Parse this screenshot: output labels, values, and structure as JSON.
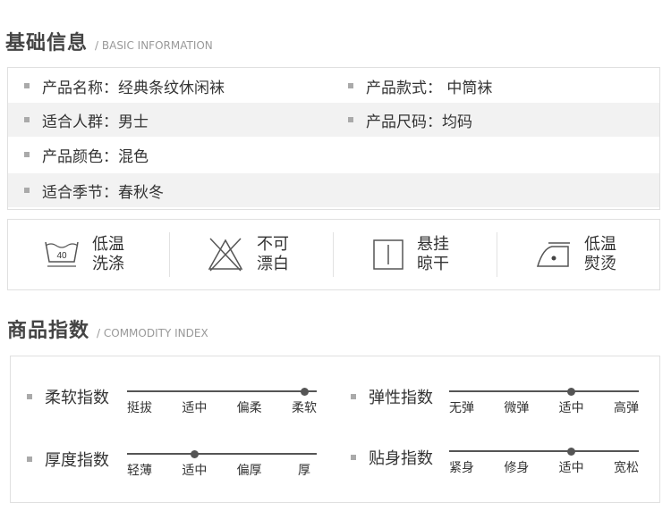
{
  "basic": {
    "title": "基础信息",
    "subtitle": "/ BASIC INFORMATION",
    "rows": [
      {
        "left": "产品名称：经典条纹休闲袜",
        "right": "产品款式：  中筒袜"
      },
      {
        "left": "适合人群：男士",
        "right": "产品尺码：均码"
      },
      {
        "left": "产品颜色：混色",
        "right": ""
      },
      {
        "left": "适合季节：春秋冬",
        "right": ""
      }
    ]
  },
  "care": [
    {
      "icon": "wash-low-temp-icon",
      "badge": "40",
      "line1": "低温",
      "line2": "洗涤"
    },
    {
      "icon": "no-bleach-icon",
      "line1": "不可",
      "line2": "漂白"
    },
    {
      "icon": "hang-dry-icon",
      "line1": "悬挂",
      "line2": "晾干"
    },
    {
      "icon": "iron-low-temp-icon",
      "line1": "低温",
      "line2": "熨烫"
    }
  ],
  "index": {
    "title": "商品指数",
    "subtitle": "/ COMMODITY INDEX",
    "items": [
      {
        "label": "柔软指数",
        "ticks": [
          "挺拔",
          "适中",
          "偏柔",
          "柔软"
        ],
        "level": 3
      },
      {
        "label": "弹性指数",
        "ticks": [
          "无弹",
          "微弹",
          "适中",
          "高弹"
        ],
        "level": 2
      },
      {
        "label": "厚度指数",
        "ticks": [
          "轻薄",
          "适中",
          "偏厚",
          "厚"
        ],
        "level": 1
      },
      {
        "label": "贴身指数",
        "ticks": [
          "紧身",
          "修身",
          "适中",
          "宽松"
        ],
        "level": 2
      }
    ]
  }
}
